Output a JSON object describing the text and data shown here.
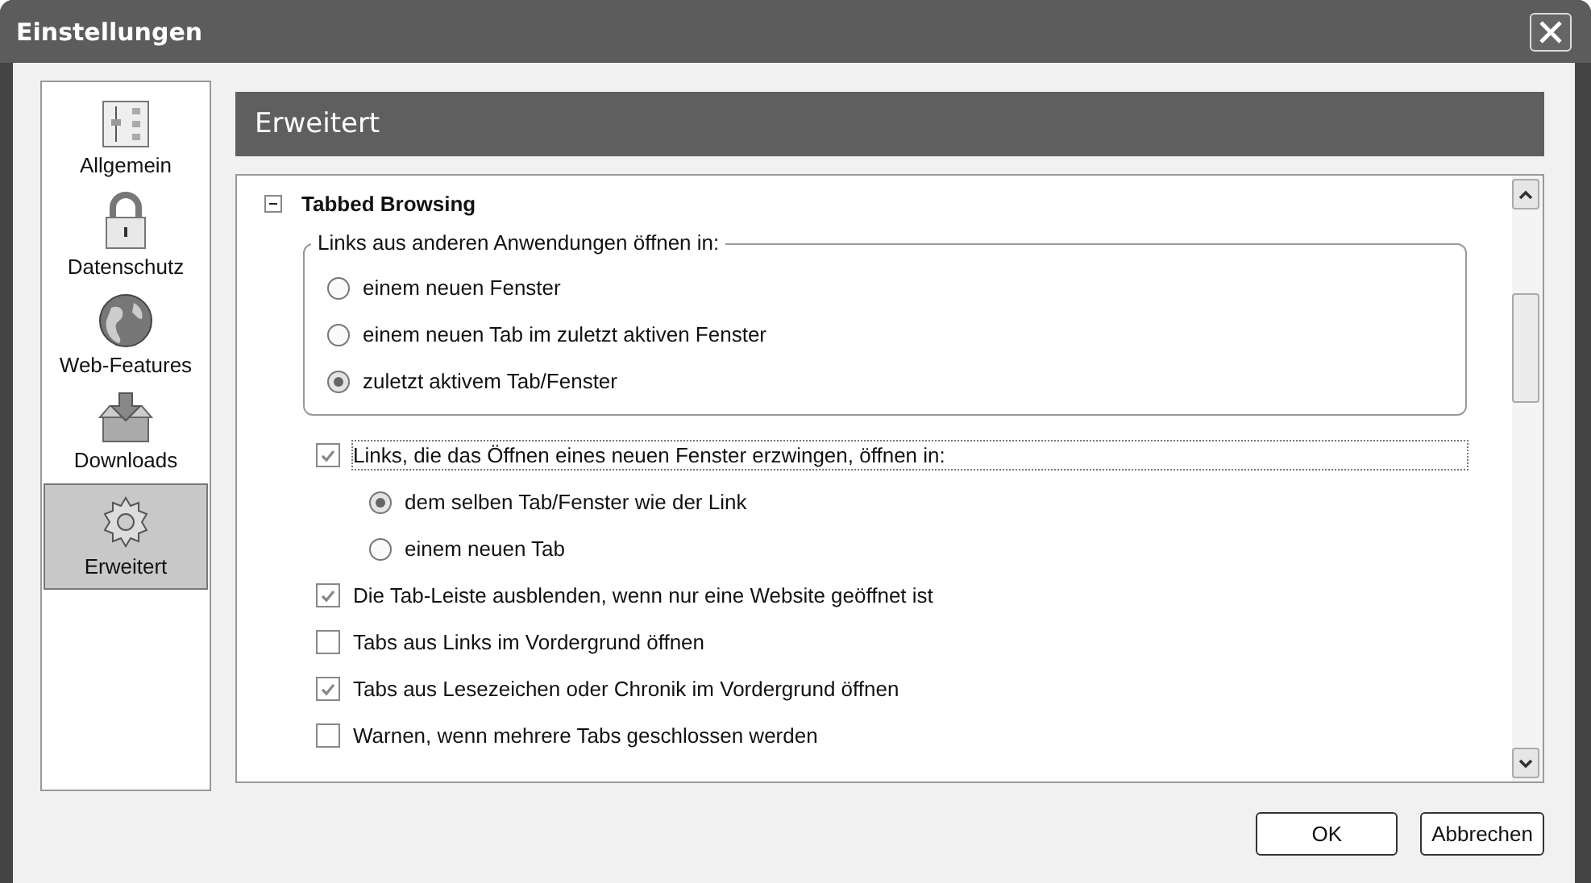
{
  "window": {
    "title": "Einstellungen"
  },
  "sidebar": {
    "items": [
      {
        "label": "Allgemein",
        "selected": false
      },
      {
        "label": "Datenschutz",
        "selected": false
      },
      {
        "label": "Web-Features",
        "selected": false
      },
      {
        "label": "Downloads",
        "selected": false
      },
      {
        "label": "Erweitert",
        "selected": true
      }
    ]
  },
  "panel": {
    "title": "Erweitert"
  },
  "section": {
    "title": "Tabbed Browsing",
    "expanded": true
  },
  "fieldset": {
    "legend": "Links aus anderen Anwendungen öffnen in:",
    "options": [
      {
        "label": "einem neuen Fenster",
        "selected": false
      },
      {
        "label": "einem neuen Tab im zuletzt aktiven Fenster",
        "selected": false
      },
      {
        "label": "zuletzt aktivem Tab/Fenster",
        "selected": true
      }
    ]
  },
  "settings": [
    {
      "label": "Links, die das Öffnen eines neuen Fenster erzwingen, öffnen in:",
      "checked": true,
      "focused": true,
      "options": [
        {
          "label": "dem selben Tab/Fenster wie der Link",
          "selected": true
        },
        {
          "label": "einem neuen Tab",
          "selected": false
        }
      ]
    },
    {
      "label": "Die Tab-Leiste ausblenden, wenn nur eine Website geöffnet ist",
      "checked": true,
      "focused": false
    },
    {
      "label": "Tabs aus Links im Vordergrund öffnen",
      "checked": false,
      "focused": false
    },
    {
      "label": "Tabs aus Lesezeichen oder Chronik im Vordergrund öffnen",
      "checked": true,
      "focused": false
    },
    {
      "label": "Warnen, wenn mehrere Tabs geschlossen werden",
      "checked": false,
      "focused": false
    }
  ],
  "buttons": [
    "OK",
    "Abbrechen"
  ]
}
